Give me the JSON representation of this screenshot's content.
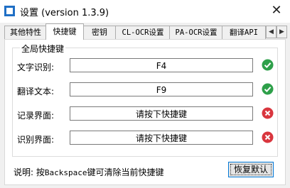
{
  "window": {
    "title": "设置 (version 1.3.9)",
    "close_glyph": "✕"
  },
  "tabs": [
    {
      "label": "其他特性"
    },
    {
      "label": "快捷键"
    },
    {
      "label": "密钥"
    },
    {
      "label": "CL-OCR设置"
    },
    {
      "label": "PA-OCR设置"
    },
    {
      "label": "翻译API"
    }
  ],
  "tab_scroll": {
    "left": "◀",
    "right": "▶"
  },
  "active_tab": "快捷键",
  "group_title": "全局快捷键",
  "rows": [
    {
      "label": "文字识别:",
      "value": "F4",
      "status": "ok",
      "status_icon": "check-circle-icon"
    },
    {
      "label": "翻译文本:",
      "value": "F9",
      "status": "ok",
      "status_icon": "check-circle-icon"
    },
    {
      "label": "记录界面:",
      "value": "请按下快捷键",
      "status": "error",
      "status_icon": "cross-circle-icon"
    },
    {
      "label": "识别界面:",
      "value": "请按下快捷键",
      "status": "error",
      "status_icon": "cross-circle-icon"
    }
  ],
  "note": {
    "prefix": "说明: 按",
    "key": "Backspace",
    "suffix": "键可清除当前快捷键"
  },
  "restore_button": "恢复默认",
  "colors": {
    "ok": "#2ea04a",
    "error": "#d9363e",
    "accent": "#0078d7"
  }
}
